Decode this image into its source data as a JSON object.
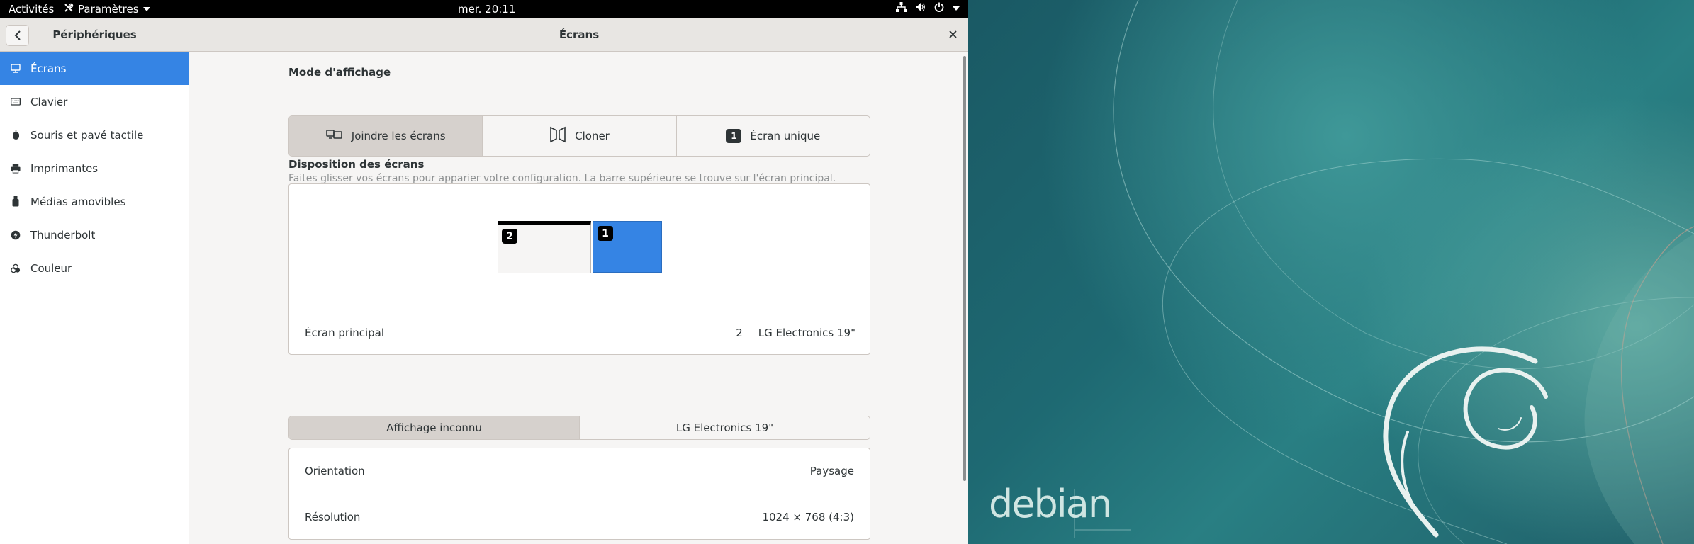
{
  "topbar": {
    "activities": "Activités",
    "app_name": "Paramètres",
    "clock": "mer. 20:11"
  },
  "window": {
    "sidebar_title": "Périphériques",
    "main_title": "Écrans"
  },
  "sidebar": {
    "items": [
      {
        "label": "Écrans",
        "icon": "display-icon"
      },
      {
        "label": "Clavier",
        "icon": "keyboard-icon"
      },
      {
        "label": "Souris et pavé tactile",
        "icon": "mouse-icon"
      },
      {
        "label": "Imprimantes",
        "icon": "printer-icon"
      },
      {
        "label": "Médias amovibles",
        "icon": "removable-media-icon"
      },
      {
        "label": "Thunderbolt",
        "icon": "thunderbolt-icon"
      },
      {
        "label": "Couleur",
        "icon": "color-icon"
      }
    ]
  },
  "display_mode": {
    "title": "Mode d'affichage",
    "options": [
      {
        "label": "Joindre les écrans"
      },
      {
        "label": "Cloner"
      },
      {
        "label": "Écran unique",
        "badge": "1"
      }
    ]
  },
  "arrangement": {
    "title": "Disposition des écrans",
    "subtitle": "Faites glisser vos écrans pour apparier votre configuration. La barre supérieure se trouve sur l'écran principal.",
    "monitors": [
      {
        "badge": "2"
      },
      {
        "badge": "1"
      }
    ],
    "primary_label": "Écran principal",
    "primary_number": "2",
    "primary_name": "LG Electronics 19\""
  },
  "monitor_tabs": [
    {
      "label": "Affichage inconnu"
    },
    {
      "label": "LG Electronics 19\""
    }
  ],
  "settings": {
    "orientation_label": "Orientation",
    "orientation_value": "Paysage",
    "resolution_label": "Résolution",
    "resolution_value": "1024 × 768 (4:3)"
  },
  "desktop": {
    "brand": "debian"
  },
  "colors": {
    "accent": "#3584e4",
    "headerbar": "#e8e6e3",
    "window_bg": "#f6f5f4"
  }
}
